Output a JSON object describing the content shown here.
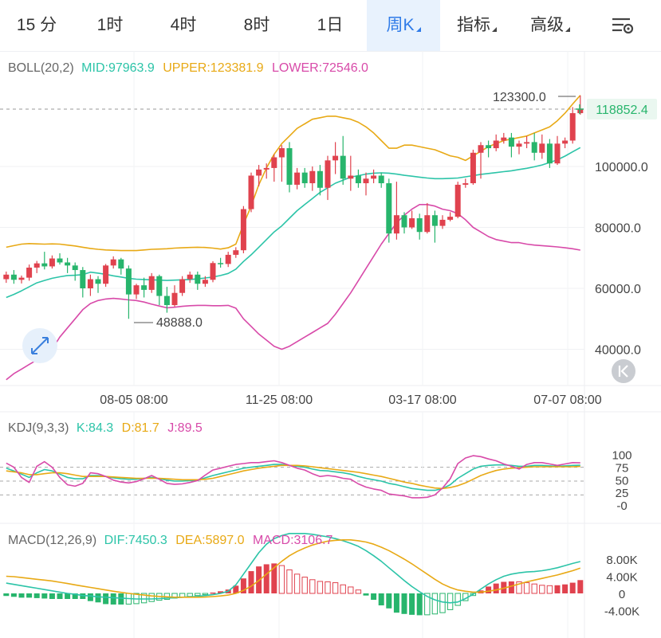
{
  "tabs": [
    {
      "label": "15 分",
      "active": false,
      "dropdown": false
    },
    {
      "label": "1时",
      "active": false,
      "dropdown": false
    },
    {
      "label": "4时",
      "active": false,
      "dropdown": false
    },
    {
      "label": "8时",
      "active": false,
      "dropdown": false
    },
    {
      "label": "1日",
      "active": false,
      "dropdown": false
    },
    {
      "label": "周K",
      "active": true,
      "dropdown": true
    },
    {
      "label": "指标",
      "active": false,
      "dropdown": true
    },
    {
      "label": "高级",
      "active": false,
      "dropdown": true
    }
  ],
  "settings_icon": "chart-settings-icon",
  "colors": {
    "up": "#e0424e",
    "down": "#27b56c",
    "mid": "#2cc4a8",
    "upper": "#e8a915",
    "lower": "#d84aa9",
    "accent": "#2f7be8",
    "price": "#27b56c"
  },
  "boll": {
    "label": "BOLL(20,2)",
    "mid": "MID:97963.9",
    "upper": "UPPER:123381.9",
    "lower": "LOWER:72546.0"
  },
  "kdj": {
    "label": "KDJ(9,3,3)",
    "k": "K:84.3",
    "d": "D:81.7",
    "j": "J:89.5"
  },
  "macd": {
    "label": "MACD(12,26,9)",
    "dif": "DIF:7450.3",
    "dea": "DEA:5897.0",
    "macd": "MACD:3106.7"
  },
  "current_price": "118852.4",
  "high_marker": "123300.0",
  "low_marker": "48888.0",
  "chart_data": {
    "type": "candlestick",
    "price_axis": {
      "ticks": [
        "100000.0",
        "80000.0",
        "60000.0",
        "40000.0"
      ]
    },
    "time_axis": {
      "ticks": [
        "08-05 08:00",
        "11-25 08:00",
        "03-17 08:00",
        "07-07 08:00"
      ]
    },
    "kdj_axis": {
      "ticks": [
        "100",
        "75",
        "50",
        "25",
        "-0"
      ]
    },
    "macd_axis": {
      "ticks": [
        "8.00K",
        "4.00K",
        "0",
        "-4.00K"
      ]
    },
    "candles": [
      [
        63000,
        64500,
        61800,
        65500
      ],
      [
        64500,
        62800,
        61500,
        66000
      ],
      [
        62800,
        63500,
        61600,
        64200
      ],
      [
        63500,
        66800,
        62500,
        67800
      ],
      [
        66800,
        68200,
        65000,
        69000
      ],
      [
        68200,
        67200,
        66200,
        72000
      ],
      [
        67200,
        69800,
        66500,
        70800
      ],
      [
        69800,
        68500,
        67800,
        71500
      ],
      [
        68500,
        67500,
        65000,
        70000
      ],
      [
        67500,
        66000,
        62500,
        68500
      ],
      [
        66000,
        60000,
        57000,
        67000
      ],
      [
        60000,
        63000,
        57500,
        64500
      ],
      [
        63000,
        61500,
        58500,
        64000
      ],
      [
        61500,
        67500,
        60500,
        68000
      ],
      [
        67500,
        69500,
        66500,
        70500
      ],
      [
        69500,
        66500,
        64500,
        70000
      ],
      [
        66500,
        58000,
        50000,
        67500
      ],
      [
        58000,
        61000,
        56500,
        61500
      ],
      [
        61000,
        59500,
        57000,
        63500
      ],
      [
        59500,
        64000,
        58500,
        65000
      ],
      [
        64000,
        57500,
        54500,
        64500
      ],
      [
        57500,
        54500,
        52000,
        60500
      ],
      [
        54500,
        58500,
        54000,
        61000
      ],
      [
        58500,
        63000,
        57500,
        64000
      ],
      [
        63000,
        64500,
        61800,
        65500
      ],
      [
        64500,
        61500,
        59500,
        65500
      ],
      [
        61500,
        62800,
        60500,
        64000
      ],
      [
        62800,
        68300,
        62000,
        68900
      ],
      [
        68300,
        68000,
        66800,
        70000
      ],
      [
        68000,
        71000,
        67000,
        72000
      ],
      [
        71000,
        72500,
        70000,
        73500
      ],
      [
        72500,
        86000,
        71500,
        87000
      ],
      [
        86000,
        97000,
        85000,
        98000
      ],
      [
        97000,
        99000,
        93500,
        100500
      ],
      [
        99000,
        99500,
        96000,
        101000
      ],
      [
        99500,
        103000,
        95000,
        104000
      ],
      [
        103000,
        106000,
        95000,
        107000
      ],
      [
        106000,
        94000,
        91500,
        108000
      ],
      [
        94000,
        98000,
        92500,
        99500
      ],
      [
        98000,
        94500,
        93000,
        99500
      ],
      [
        94500,
        98500,
        92000,
        100000
      ],
      [
        98500,
        93000,
        90500,
        100500
      ],
      [
        93000,
        102000,
        89000,
        103500
      ],
      [
        102000,
        103500,
        97500,
        108000
      ],
      [
        103500,
        96000,
        94000,
        110000
      ],
      [
        96000,
        97000,
        92000,
        103500
      ],
      [
        97000,
        94500,
        93000,
        99000
      ],
      [
        94500,
        96000,
        90500,
        98000
      ],
      [
        96000,
        97000,
        94500,
        99000
      ],
      [
        97000,
        94500,
        93000,
        98000
      ],
      [
        94500,
        78000,
        75000,
        96000
      ],
      [
        78000,
        84000,
        76000,
        95000
      ],
      [
        84000,
        80000,
        78000,
        85000
      ],
      [
        80000,
        83000,
        79500,
        85500
      ],
      [
        83000,
        78500,
        76000,
        84500
      ],
      [
        78500,
        84000,
        78000,
        88000
      ],
      [
        84000,
        80500,
        75000,
        85500
      ],
      [
        80500,
        82500,
        79500,
        84000
      ],
      [
        82500,
        83500,
        82000,
        85000
      ],
      [
        83500,
        94000,
        83000,
        95000
      ],
      [
        94000,
        94500,
        93000,
        96000
      ],
      [
        94500,
        104500,
        94000,
        105500
      ],
      [
        104500,
        107000,
        96000,
        108000
      ],
      [
        107000,
        106000,
        103000,
        108500
      ],
      [
        106000,
        108500,
        105000,
        110500
      ],
      [
        108500,
        109500,
        107500,
        111000
      ],
      [
        109500,
        106500,
        103000,
        111000
      ],
      [
        106500,
        107500,
        104000,
        108500
      ],
      [
        107500,
        108000,
        106000,
        110000
      ],
      [
        108000,
        104500,
        102000,
        111000
      ],
      [
        104500,
        107500,
        102500,
        110500
      ],
      [
        107500,
        101000,
        99500,
        109000
      ],
      [
        101000,
        107500,
        100500,
        110000
      ],
      [
        107500,
        108500,
        106000,
        109500
      ],
      [
        108500,
        117500,
        107500,
        119500
      ],
      [
        117500,
        118852.4,
        117000,
        123300
      ]
    ],
    "boll": {
      "mid": [
        57000,
        58000,
        59200,
        60500,
        61800,
        62600,
        63300,
        63800,
        64200,
        64300,
        64500,
        65300,
        65000,
        64600,
        64100,
        63700,
        63300,
        63000,
        62900,
        62800,
        62700,
        62600,
        62700,
        62800,
        62900,
        63100,
        63400,
        63700,
        64200,
        64900,
        66300,
        68800,
        71000,
        73500,
        76000,
        78500,
        80500,
        83000,
        85500,
        87500,
        89500,
        91500,
        93000,
        94500,
        95500,
        96500,
        97000,
        97500,
        97800,
        97900,
        97800,
        97500,
        97100,
        96800,
        96500,
        96200,
        96000,
        96000,
        96100,
        96200,
        96600,
        97000,
        97400,
        97700,
        98000,
        98300,
        98600,
        99000,
        99400,
        99900,
        100500,
        101300,
        102200,
        103400,
        104800,
        106200
      ],
      "upper": [
        73500,
        74000,
        74500,
        74700,
        74600,
        74500,
        74600,
        74500,
        74200,
        73900,
        73500,
        73100,
        72800,
        72600,
        72500,
        72400,
        72400,
        72400,
        72600,
        72800,
        72900,
        73000,
        73200,
        73300,
        73400,
        73500,
        73400,
        73200,
        72900,
        73300,
        74500,
        81000,
        87000,
        94000,
        99500,
        104000,
        107500,
        110000,
        112500,
        114000,
        115500,
        116000,
        116500,
        116500,
        116000,
        115500,
        114500,
        113000,
        111000,
        108500,
        106000,
        106000,
        107000,
        107000,
        106500,
        106000,
        105500,
        104500,
        103500,
        103000,
        102000,
        103500,
        105000,
        106500,
        107500,
        108500,
        109000,
        109500,
        110000,
        111000,
        112000,
        113000,
        115000,
        117500,
        120500,
        123381.9
      ],
      "lower": [
        30000,
        32000,
        33500,
        35000,
        36500,
        38000,
        40000,
        44000,
        47000,
        50000,
        53000,
        55000,
        56000,
        56500,
        56700,
        56500,
        56200,
        56000,
        55500,
        54800,
        54200,
        53600,
        53800,
        54100,
        54300,
        54400,
        54400,
        54300,
        54300,
        54400,
        53500,
        50000,
        47500,
        45000,
        43000,
        41000,
        40000,
        41000,
        42500,
        44000,
        45500,
        47000,
        48500,
        51500,
        55000,
        58500,
        62500,
        66500,
        70500,
        74500,
        78000,
        81500,
        84000,
        86000,
        87500,
        87500,
        87000,
        86000,
        85500,
        84500,
        82500,
        80000,
        78500,
        77000,
        76000,
        75500,
        75000,
        75000,
        74500,
        74200,
        74000,
        73800,
        73600,
        73300,
        73000,
        72546
      ]
    },
    "kdj": {
      "k": [
        78,
        72,
        65,
        58,
        68,
        75,
        72,
        65,
        58,
        55,
        55,
        62,
        62,
        60,
        57,
        55,
        54,
        54,
        56,
        58,
        55,
        52,
        50,
        50,
        51,
        52,
        57,
        62,
        66,
        70,
        74,
        78,
        80,
        82,
        84,
        86,
        86,
        84,
        82,
        80,
        76,
        73,
        72,
        70,
        68,
        65,
        60,
        56,
        53,
        50,
        45,
        42,
        38,
        34,
        32,
        30,
        30,
        34,
        42,
        56,
        66,
        76,
        82,
        84,
        85,
        85,
        84,
        82,
        82,
        84,
        84,
        83,
        82,
        83,
        84,
        84.3
      ],
      "d": [
        72,
        70,
        68,
        64,
        64,
        66,
        68,
        68,
        66,
        63,
        60,
        60,
        60,
        60,
        59,
        58,
        57,
        56,
        56,
        56,
        56,
        55,
        54,
        53,
        53,
        53,
        54,
        56,
        60,
        64,
        68,
        72,
        75,
        78,
        80,
        82,
        84,
        84,
        84,
        83,
        81,
        79,
        77,
        75,
        73,
        71,
        69,
        66,
        63,
        60,
        56,
        52,
        48,
        45,
        41,
        38,
        35,
        34,
        36,
        40,
        46,
        54,
        62,
        68,
        73,
        76,
        78,
        79,
        80,
        81,
        81,
        81,
        81,
        81,
        81,
        81.7
      ],
      "j": [
        89,
        80,
        58,
        47,
        82,
        92,
        80,
        58,
        42,
        39,
        45,
        68,
        66,
        60,
        52,
        48,
        46,
        49,
        55,
        62,
        54,
        45,
        43,
        44,
        47,
        51,
        63,
        74,
        78,
        82,
        86,
        88,
        90,
        90,
        92,
        94,
        90,
        84,
        78,
        74,
        66,
        60,
        62,
        60,
        56,
        54,
        44,
        37,
        33,
        30,
        22,
        20,
        18,
        14,
        14,
        15,
        20,
        35,
        55,
        88,
        100,
        105,
        103,
        98,
        94,
        87,
        82,
        76,
        86,
        90,
        90,
        87,
        84,
        87,
        90,
        89.5
      ]
    },
    "macd": {
      "dif": [
        2400,
        2100,
        1800,
        1500,
        1200,
        900,
        600,
        300,
        0,
        -200,
        -500,
        -600,
        -800,
        -900,
        -1000,
        -1100,
        -1200,
        -1300,
        -1300,
        -1300,
        -1200,
        -1100,
        -1000,
        -900,
        -800,
        -700,
        -500,
        -300,
        0,
        500,
        2000,
        4500,
        7000,
        9500,
        11500,
        12800,
        13500,
        14000,
        14000,
        14000,
        13800,
        13500,
        13200,
        12800,
        12300,
        11700,
        11000,
        10000,
        8800,
        7500,
        6000,
        4500,
        3000,
        1600,
        400,
        -700,
        -1500,
        -2000,
        -2200,
        -2000,
        -1200,
        -200,
        1000,
        2200,
        3200,
        4000,
        4500,
        4800,
        5000,
        5100,
        5300,
        5600,
        6000,
        6500,
        7000,
        7450.3
      ],
      "dea": [
        4000,
        3900,
        3700,
        3500,
        3300,
        3100,
        2900,
        2600,
        2300,
        2000,
        1700,
        1400,
        1100,
        800,
        500,
        250,
        0,
        -200,
        -400,
        -600,
        -700,
        -800,
        -900,
        -900,
        -900,
        -900,
        -850,
        -750,
        -600,
        -400,
        0,
        700,
        1700,
        3000,
        4500,
        6000,
        7500,
        8800,
        9800,
        10600,
        11300,
        11800,
        12200,
        12400,
        12500,
        12500,
        12300,
        12000,
        11500,
        10800,
        10000,
        9000,
        8000,
        6900,
        5700,
        4500,
        3300,
        2200,
        1400,
        800,
        500,
        300,
        300,
        500,
        800,
        1200,
        1700,
        2200,
        2700,
        3100,
        3500,
        3900,
        4300,
        4800,
        5300,
        5897
      ],
      "hist": [
        -600,
        -800,
        -1000,
        -1000,
        -1100,
        -1200,
        -1300,
        -1300,
        -1300,
        -1300,
        -1300,
        -1800,
        -2100,
        -2500,
        -2600,
        -2600,
        -2500,
        -2400,
        -2200,
        -1900,
        -1600,
        -1400,
        -1100,
        -900,
        -700,
        -500,
        -300,
        200,
        500,
        900,
        1800,
        3500,
        5200,
        6300,
        6800,
        7000,
        6500,
        5500,
        4500,
        3800,
        3200,
        2800,
        2700,
        2500,
        2000,
        1500,
        800,
        -500,
        -1500,
        -2800,
        -3500,
        -4500,
        -4800,
        -5000,
        -5100,
        -5000,
        -4800,
        -4500,
        -3800,
        -2800,
        -1700,
        -500,
        700,
        1600,
        2300,
        2700,
        2800,
        2700,
        2500,
        2200,
        1900,
        1800,
        1900,
        2100,
        2500,
        3106.7
      ]
    }
  }
}
